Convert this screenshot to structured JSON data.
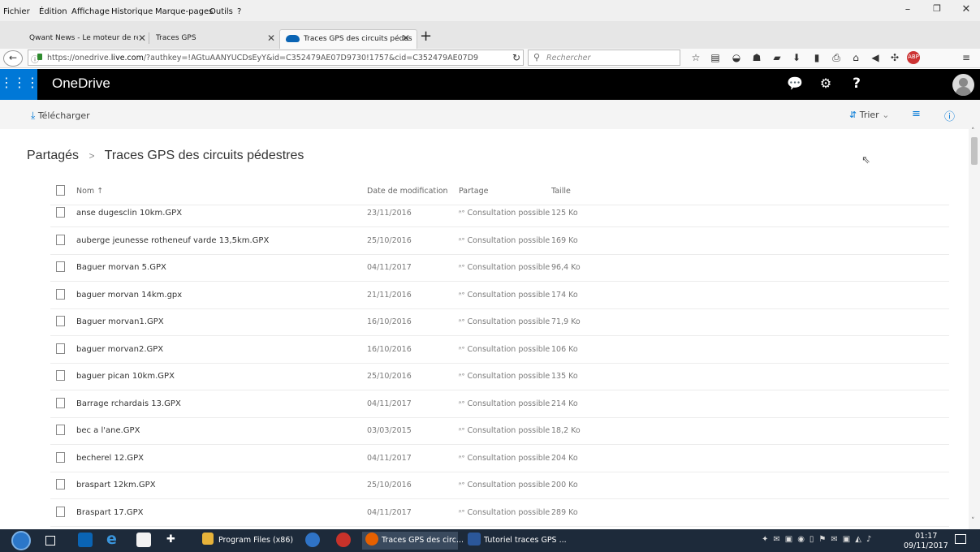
{
  "menu": [
    "Fichier",
    "Édition",
    "Affichage",
    "Historique",
    "Marque-pages",
    "Outils",
    "?"
  ],
  "menu_underline": [
    "F",
    "n",
    "A",
    "H",
    "M",
    "O",
    "?"
  ],
  "tabs": [
    {
      "label": "Qwant News - Le moteur de rech",
      "active": false
    },
    {
      "label": "Traces GPS",
      "active": false
    },
    {
      "label": "Traces GPS des circuits pédes",
      "active": true
    }
  ],
  "address": {
    "url_prefix": "https://onedrive.",
    "url_domain": "live.com",
    "url_rest": "/?authkey=!AGtuAANYUCDsEyY&id=C352479AE07D9730!1757&cid=C352479AE07D9",
    "search_placeholder": "Rechercher"
  },
  "onedrive": {
    "brand": "OneDrive",
    "command": {
      "download": "Télécharger",
      "sort": "Trier"
    }
  },
  "breadcrumb": {
    "root": "Partagés",
    "separator": ">",
    "current": "Traces GPS des circuits pédestres"
  },
  "columns": {
    "name": "Nom ↑",
    "modified": "Date de modification",
    "sharing": "Partage",
    "size": "Taille"
  },
  "files": [
    {
      "name": "anse dugesclin 10km.GPX",
      "date": "23/11/2016",
      "share": "Consultation possible",
      "size": "125 Ko"
    },
    {
      "name": "auberge jeunesse rotheneuf varde 13,5km.GPX",
      "date": "25/10/2016",
      "share": "Consultation possible",
      "size": "169 Ko"
    },
    {
      "name": "Baguer morvan 5.GPX",
      "date": "04/11/2017",
      "share": "Consultation possible",
      "size": "96,4 Ko"
    },
    {
      "name": "baguer morvan 14km.gpx",
      "date": "21/11/2016",
      "share": "Consultation possible",
      "size": "174 Ko"
    },
    {
      "name": "Baguer morvan1.GPX",
      "date": "16/10/2016",
      "share": "Consultation possible",
      "size": "71,9 Ko"
    },
    {
      "name": "baguer morvan2.GPX",
      "date": "16/10/2016",
      "share": "Consultation possible",
      "size": "106 Ko"
    },
    {
      "name": "baguer pican 10km.GPX",
      "date": "25/10/2016",
      "share": "Consultation possible",
      "size": "135 Ko"
    },
    {
      "name": "Barrage rchardais 13.GPX",
      "date": "04/11/2017",
      "share": "Consultation possible",
      "size": "214 Ko"
    },
    {
      "name": "bec a l'ane.GPX",
      "date": "03/03/2015",
      "share": "Consultation possible",
      "size": "18,2 Ko"
    },
    {
      "name": "becherel 12.GPX",
      "date": "04/11/2017",
      "share": "Consultation possible",
      "size": "204 Ko"
    },
    {
      "name": "braspart 12km.GPX",
      "date": "25/10/2016",
      "share": "Consultation possible",
      "size": "200 Ko"
    },
    {
      "name": "Braspart 17.GPX",
      "date": "04/11/2017",
      "share": "Consultation possible",
      "size": "289 Ko"
    }
  ],
  "taskbar": {
    "apps": [
      "Program Files (x86)",
      "Traces GPS des circ...",
      "Tutoriel traces GPS ..."
    ],
    "time": "01:17",
    "date": "09/11/2017"
  },
  "colors": {
    "accent": "#0078d7",
    "header": "#000000",
    "taskbar": "#1d2a3a"
  }
}
